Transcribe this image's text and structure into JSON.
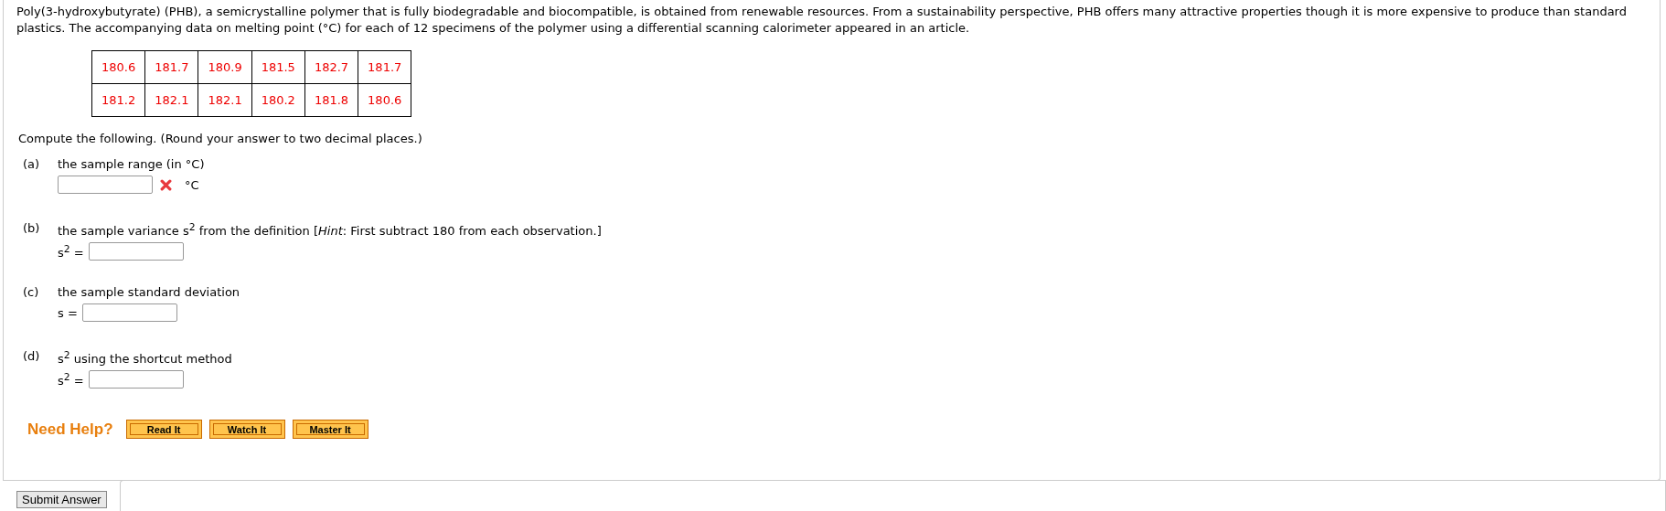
{
  "intro": "Poly(3-hydroxybutyrate) (PHB), a semicrystalline polymer that is fully biodegradable and biocompatible, is obtained from renewable resources. From a sustainability perspective, PHB offers many attractive properties though it is more expensive to produce than standard plastics. The accompanying data on melting point (°C) for each of 12 specimens of the polymer using a differential scanning calorimeter appeared in an article.",
  "data_table": {
    "rows": [
      [
        "180.6",
        "181.7",
        "180.9",
        "181.5",
        "182.7",
        "181.7"
      ],
      [
        "181.2",
        "182.1",
        "182.1",
        "180.2",
        "181.8",
        "180.6"
      ]
    ]
  },
  "instruction": "Compute the following. (Round your answer to two decimal places.)",
  "parts": [
    {
      "label": "(a)",
      "text": "the sample range (in °C)",
      "unit": "°C",
      "incorrect": true
    },
    {
      "label": "(b)",
      "text": "the sample variance s$^{2}$ from the definition [*Hint*: First subtract 180 from each observation.]",
      "prefix": "s$^{2}$ =",
      "incorrect": false
    },
    {
      "label": "(c)",
      "text": "the sample standard deviation",
      "prefix": "s =",
      "incorrect": false
    },
    {
      "label": "(d)",
      "text": "s$^{2}$ using the shortcut method",
      "prefix": "s$^{2}$ =",
      "incorrect": false
    }
  ],
  "help": {
    "title": "Need Help?",
    "buttons": [
      "Read It",
      "Watch It",
      "Master It"
    ]
  },
  "submit_button": "Submit Answer"
}
